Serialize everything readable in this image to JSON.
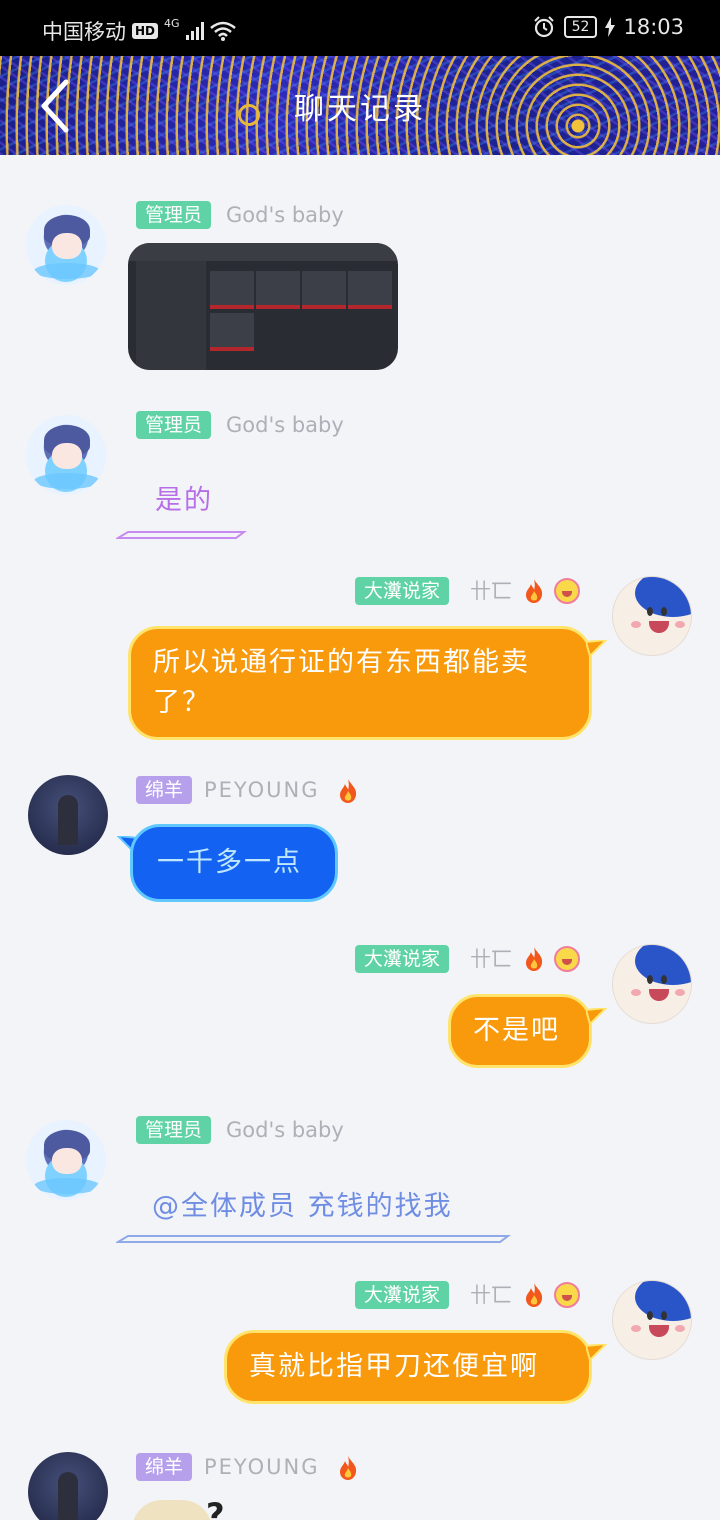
{
  "status_bar": {
    "carrier": "中国移动",
    "hd": "HD",
    "network": "4G",
    "battery": "52",
    "time": "18:03"
  },
  "header": {
    "title": "聊天记录"
  },
  "messages": [
    {
      "sender_badge": "管理员",
      "sender_name": "God's baby",
      "type": "image"
    },
    {
      "sender_badge": "管理员",
      "sender_name": "God's baby",
      "text": "是的"
    },
    {
      "sender_badge": "大瀵说家",
      "sender_name": "卄匸",
      "text": "所以说通行证的有东西都能卖了？"
    },
    {
      "sender_badge": "绵羊",
      "sender_name": "PEYOUNG",
      "text": "一千多一点"
    },
    {
      "sender_badge": "大瀵说家",
      "sender_name": "卄匸",
      "text": "不是吧"
    },
    {
      "sender_badge": "管理员",
      "sender_name": "God's baby",
      "text": "@全体成员 充钱的找我"
    },
    {
      "sender_badge": "大瀵说家",
      "sender_name": "卄匸",
      "text": "真就比指甲刀还便宜啊"
    },
    {
      "sender_badge": "绵羊",
      "sender_name": "PEYOUNG",
      "text": "?"
    }
  ],
  "colors": {
    "orange_bubble": "#f89a0c",
    "blue_bubble": "#1462f2",
    "admin_badge": "#5fd3a5",
    "sheep_badge": "#b6a0eb"
  }
}
